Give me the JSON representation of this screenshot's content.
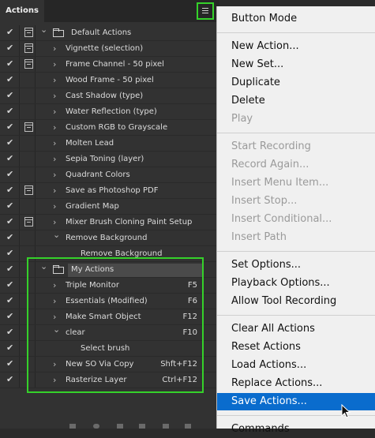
{
  "panel": {
    "tab_label": "Actions",
    "rows": [
      {
        "label": "Default Actions",
        "checked": true,
        "dialog": true,
        "type": "set",
        "expanded": true
      },
      {
        "label": "Vignette (selection)",
        "checked": true,
        "dialog": true,
        "type": "action"
      },
      {
        "label": "Frame Channel - 50 pixel",
        "checked": true,
        "dialog": true,
        "type": "action"
      },
      {
        "label": "Wood Frame - 50 pixel",
        "checked": true,
        "dialog": false,
        "type": "action"
      },
      {
        "label": "Cast Shadow (type)",
        "checked": true,
        "dialog": false,
        "type": "action"
      },
      {
        "label": "Water Reflection (type)",
        "checked": true,
        "dialog": false,
        "type": "action"
      },
      {
        "label": "Custom RGB to Grayscale",
        "checked": true,
        "dialog": true,
        "type": "action"
      },
      {
        "label": "Molten Lead",
        "checked": true,
        "dialog": false,
        "type": "action"
      },
      {
        "label": "Sepia Toning (layer)",
        "checked": true,
        "dialog": false,
        "type": "action"
      },
      {
        "label": "Quadrant Colors",
        "checked": true,
        "dialog": false,
        "type": "action"
      },
      {
        "label": "Save as Photoshop PDF",
        "checked": true,
        "dialog": true,
        "type": "action"
      },
      {
        "label": "Gradient Map",
        "checked": true,
        "dialog": false,
        "type": "action"
      },
      {
        "label": "Mixer Brush Cloning Paint Setup",
        "checked": true,
        "dialog": true,
        "type": "action"
      },
      {
        "label": "Remove Background",
        "checked": true,
        "dialog": false,
        "type": "action",
        "expanded": true
      },
      {
        "label": "Remove Background",
        "checked": true,
        "dialog": false,
        "type": "step"
      },
      {
        "label": "My Actions",
        "checked": true,
        "dialog": false,
        "type": "set",
        "expanded": true,
        "selected": true
      },
      {
        "label": "Triple Monitor",
        "key": "F5",
        "checked": true,
        "dialog": false,
        "type": "action"
      },
      {
        "label": "Essentials (Modified)",
        "key": "F6",
        "checked": true,
        "dialog": false,
        "type": "action"
      },
      {
        "label": "Make Smart Object",
        "key": "F12",
        "checked": true,
        "dialog": false,
        "type": "action"
      },
      {
        "label": "clear",
        "key": "F10",
        "checked": true,
        "dialog": false,
        "type": "action",
        "expanded": true
      },
      {
        "label": "Select brush",
        "checked": true,
        "dialog": false,
        "type": "step"
      },
      {
        "label": "New SO Via Copy",
        "key": "Shft+F12",
        "checked": true,
        "dialog": false,
        "type": "action"
      },
      {
        "label": "Rasterize Layer",
        "key": "Ctrl+F12",
        "checked": true,
        "dialog": false,
        "type": "action"
      }
    ]
  },
  "menu": {
    "groups": [
      [
        {
          "label": "Button Mode",
          "enabled": true
        }
      ],
      [
        {
          "label": "New Action...",
          "enabled": true
        },
        {
          "label": "New Set...",
          "enabled": true
        },
        {
          "label": "Duplicate",
          "enabled": true
        },
        {
          "label": "Delete",
          "enabled": true
        },
        {
          "label": "Play",
          "enabled": false
        }
      ],
      [
        {
          "label": "Start Recording",
          "enabled": false
        },
        {
          "label": "Record Again...",
          "enabled": false
        },
        {
          "label": "Insert Menu Item...",
          "enabled": false
        },
        {
          "label": "Insert Stop...",
          "enabled": false
        },
        {
          "label": "Insert Conditional...",
          "enabled": false
        },
        {
          "label": "Insert Path",
          "enabled": false
        }
      ],
      [
        {
          "label": "Set Options...",
          "enabled": true
        },
        {
          "label": "Playback Options...",
          "enabled": true
        },
        {
          "label": "Allow Tool Recording",
          "enabled": true
        }
      ],
      [
        {
          "label": "Clear All Actions",
          "enabled": true
        },
        {
          "label": "Reset Actions",
          "enabled": true
        },
        {
          "label": "Load Actions...",
          "enabled": true
        },
        {
          "label": "Replace Actions...",
          "enabled": true
        },
        {
          "label": "Save Actions...",
          "enabled": true,
          "highlighted": true
        }
      ],
      [
        {
          "label": "Commands",
          "enabled": true
        }
      ]
    ]
  },
  "colors": {
    "highlight_box": "#35d12a",
    "menu_highlight": "#0a6ccd",
    "panel_bg": "#323232"
  }
}
